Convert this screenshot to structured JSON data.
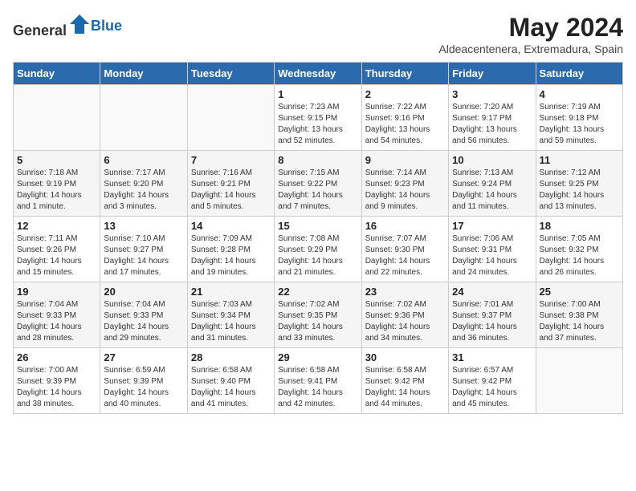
{
  "header": {
    "logo_general": "General",
    "logo_blue": "Blue",
    "month_year": "May 2024",
    "location": "Aldeacentenera, Extremadura, Spain"
  },
  "columns": [
    "Sunday",
    "Monday",
    "Tuesday",
    "Wednesday",
    "Thursday",
    "Friday",
    "Saturday"
  ],
  "weeks": [
    [
      {
        "day": "",
        "sunrise": "",
        "sunset": "",
        "daylight": ""
      },
      {
        "day": "",
        "sunrise": "",
        "sunset": "",
        "daylight": ""
      },
      {
        "day": "",
        "sunrise": "",
        "sunset": "",
        "daylight": ""
      },
      {
        "day": "1",
        "sunrise": "Sunrise: 7:23 AM",
        "sunset": "Sunset: 9:15 PM",
        "daylight": "Daylight: 13 hours and 52 minutes."
      },
      {
        "day": "2",
        "sunrise": "Sunrise: 7:22 AM",
        "sunset": "Sunset: 9:16 PM",
        "daylight": "Daylight: 13 hours and 54 minutes."
      },
      {
        "day": "3",
        "sunrise": "Sunrise: 7:20 AM",
        "sunset": "Sunset: 9:17 PM",
        "daylight": "Daylight: 13 hours and 56 minutes."
      },
      {
        "day": "4",
        "sunrise": "Sunrise: 7:19 AM",
        "sunset": "Sunset: 9:18 PM",
        "daylight": "Daylight: 13 hours and 59 minutes."
      }
    ],
    [
      {
        "day": "5",
        "sunrise": "Sunrise: 7:18 AM",
        "sunset": "Sunset: 9:19 PM",
        "daylight": "Daylight: 14 hours and 1 minute."
      },
      {
        "day": "6",
        "sunrise": "Sunrise: 7:17 AM",
        "sunset": "Sunset: 9:20 PM",
        "daylight": "Daylight: 14 hours and 3 minutes."
      },
      {
        "day": "7",
        "sunrise": "Sunrise: 7:16 AM",
        "sunset": "Sunset: 9:21 PM",
        "daylight": "Daylight: 14 hours and 5 minutes."
      },
      {
        "day": "8",
        "sunrise": "Sunrise: 7:15 AM",
        "sunset": "Sunset: 9:22 PM",
        "daylight": "Daylight: 14 hours and 7 minutes."
      },
      {
        "day": "9",
        "sunrise": "Sunrise: 7:14 AM",
        "sunset": "Sunset: 9:23 PM",
        "daylight": "Daylight: 14 hours and 9 minutes."
      },
      {
        "day": "10",
        "sunrise": "Sunrise: 7:13 AM",
        "sunset": "Sunset: 9:24 PM",
        "daylight": "Daylight: 14 hours and 11 minutes."
      },
      {
        "day": "11",
        "sunrise": "Sunrise: 7:12 AM",
        "sunset": "Sunset: 9:25 PM",
        "daylight": "Daylight: 14 hours and 13 minutes."
      }
    ],
    [
      {
        "day": "12",
        "sunrise": "Sunrise: 7:11 AM",
        "sunset": "Sunset: 9:26 PM",
        "daylight": "Daylight: 14 hours and 15 minutes."
      },
      {
        "day": "13",
        "sunrise": "Sunrise: 7:10 AM",
        "sunset": "Sunset: 9:27 PM",
        "daylight": "Daylight: 14 hours and 17 minutes."
      },
      {
        "day": "14",
        "sunrise": "Sunrise: 7:09 AM",
        "sunset": "Sunset: 9:28 PM",
        "daylight": "Daylight: 14 hours and 19 minutes."
      },
      {
        "day": "15",
        "sunrise": "Sunrise: 7:08 AM",
        "sunset": "Sunset: 9:29 PM",
        "daylight": "Daylight: 14 hours and 21 minutes."
      },
      {
        "day": "16",
        "sunrise": "Sunrise: 7:07 AM",
        "sunset": "Sunset: 9:30 PM",
        "daylight": "Daylight: 14 hours and 22 minutes."
      },
      {
        "day": "17",
        "sunrise": "Sunrise: 7:06 AM",
        "sunset": "Sunset: 9:31 PM",
        "daylight": "Daylight: 14 hours and 24 minutes."
      },
      {
        "day": "18",
        "sunrise": "Sunrise: 7:05 AM",
        "sunset": "Sunset: 9:32 PM",
        "daylight": "Daylight: 14 hours and 26 minutes."
      }
    ],
    [
      {
        "day": "19",
        "sunrise": "Sunrise: 7:04 AM",
        "sunset": "Sunset: 9:33 PM",
        "daylight": "Daylight: 14 hours and 28 minutes."
      },
      {
        "day": "20",
        "sunrise": "Sunrise: 7:04 AM",
        "sunset": "Sunset: 9:33 PM",
        "daylight": "Daylight: 14 hours and 29 minutes."
      },
      {
        "day": "21",
        "sunrise": "Sunrise: 7:03 AM",
        "sunset": "Sunset: 9:34 PM",
        "daylight": "Daylight: 14 hours and 31 minutes."
      },
      {
        "day": "22",
        "sunrise": "Sunrise: 7:02 AM",
        "sunset": "Sunset: 9:35 PM",
        "daylight": "Daylight: 14 hours and 33 minutes."
      },
      {
        "day": "23",
        "sunrise": "Sunrise: 7:02 AM",
        "sunset": "Sunset: 9:36 PM",
        "daylight": "Daylight: 14 hours and 34 minutes."
      },
      {
        "day": "24",
        "sunrise": "Sunrise: 7:01 AM",
        "sunset": "Sunset: 9:37 PM",
        "daylight": "Daylight: 14 hours and 36 minutes."
      },
      {
        "day": "25",
        "sunrise": "Sunrise: 7:00 AM",
        "sunset": "Sunset: 9:38 PM",
        "daylight": "Daylight: 14 hours and 37 minutes."
      }
    ],
    [
      {
        "day": "26",
        "sunrise": "Sunrise: 7:00 AM",
        "sunset": "Sunset: 9:39 PM",
        "daylight": "Daylight: 14 hours and 38 minutes."
      },
      {
        "day": "27",
        "sunrise": "Sunrise: 6:59 AM",
        "sunset": "Sunset: 9:39 PM",
        "daylight": "Daylight: 14 hours and 40 minutes."
      },
      {
        "day": "28",
        "sunrise": "Sunrise: 6:58 AM",
        "sunset": "Sunset: 9:40 PM",
        "daylight": "Daylight: 14 hours and 41 minutes."
      },
      {
        "day": "29",
        "sunrise": "Sunrise: 6:58 AM",
        "sunset": "Sunset: 9:41 PM",
        "daylight": "Daylight: 14 hours and 42 minutes."
      },
      {
        "day": "30",
        "sunrise": "Sunrise: 6:58 AM",
        "sunset": "Sunset: 9:42 PM",
        "daylight": "Daylight: 14 hours and 44 minutes."
      },
      {
        "day": "31",
        "sunrise": "Sunrise: 6:57 AM",
        "sunset": "Sunset: 9:42 PM",
        "daylight": "Daylight: 14 hours and 45 minutes."
      },
      {
        "day": "",
        "sunrise": "",
        "sunset": "",
        "daylight": ""
      }
    ]
  ]
}
